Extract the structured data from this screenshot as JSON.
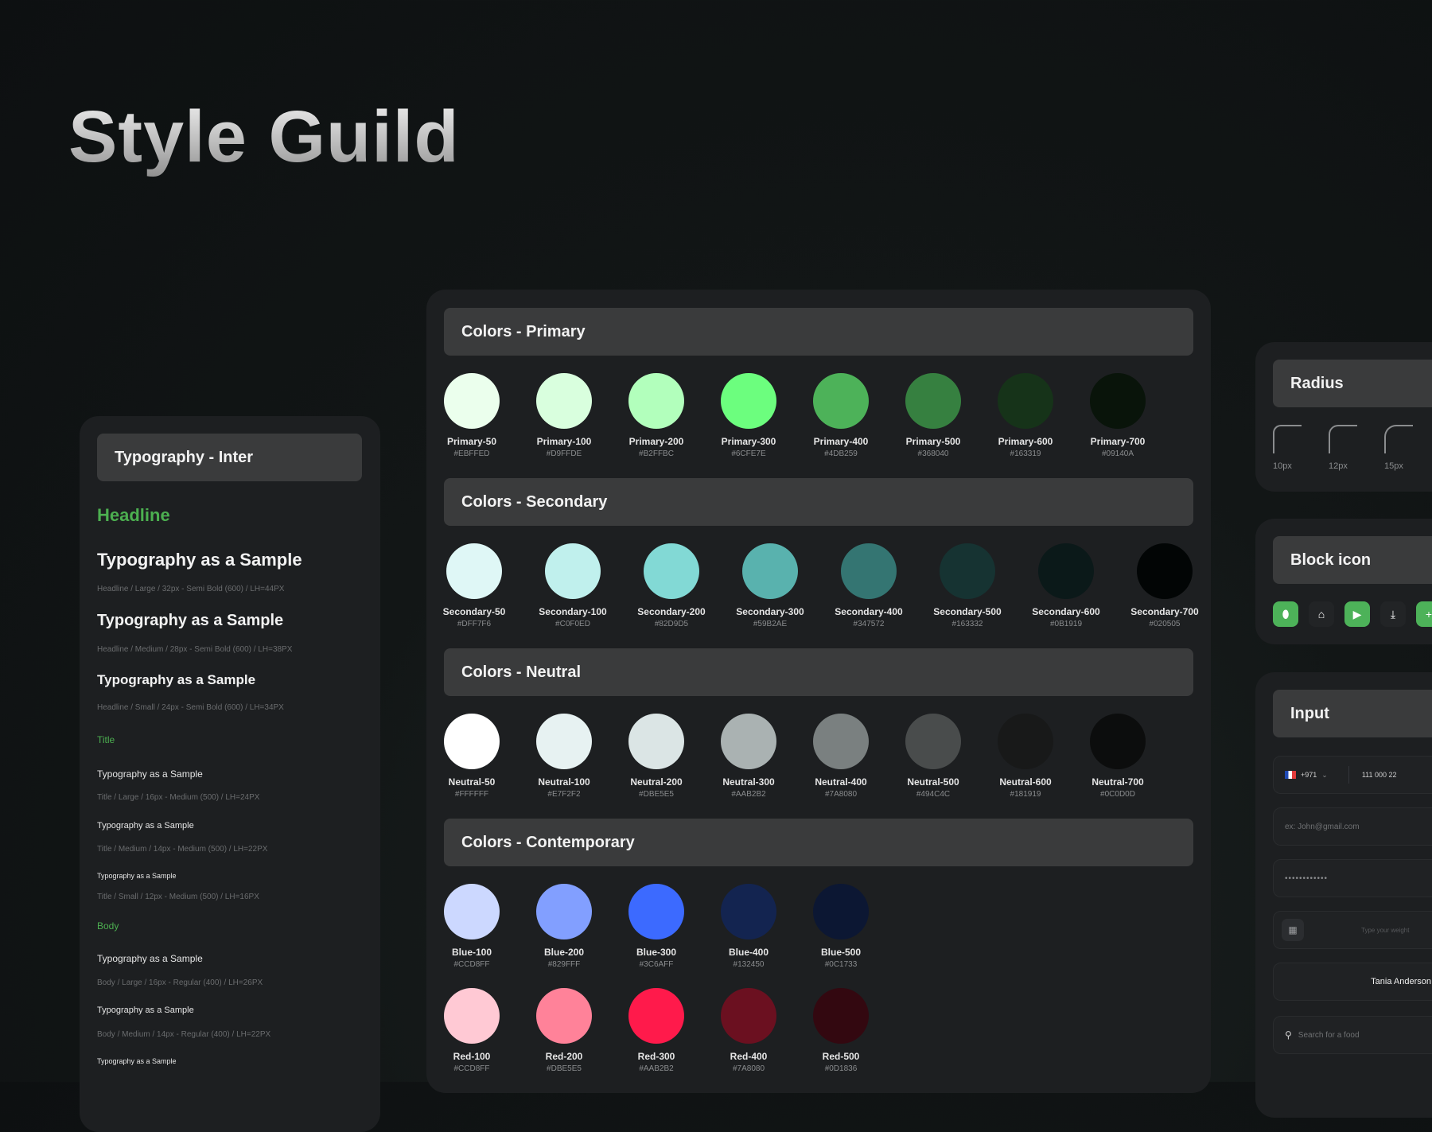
{
  "page_title": "Style Guild",
  "typography": {
    "header": "Typography - Inter",
    "headline_label": "Headline",
    "samples": [
      {
        "text": "Typography as a Sample",
        "meta": "Headline / Large / 32px - Semi Bold (600) / LH=44PX"
      },
      {
        "text": "Typography as a Sample",
        "meta": "Headline / Medium / 28px - Semi Bold (600) / LH=38PX"
      },
      {
        "text": "Typography as a Sample",
        "meta": "Headline / Small / 24px - Semi Bold (600) / LH=34PX"
      }
    ],
    "title_label": "Title",
    "title_samples": [
      {
        "text": "Typography as a Sample",
        "meta": "Title / Large / 16px - Medium (500) / LH=24PX"
      },
      {
        "text": "Typography as a Sample",
        "meta": "Title / Medium / 14px - Medium (500) / LH=22PX"
      },
      {
        "text": "Typography as a Sample",
        "meta": "Title / Small / 12px - Medium (500) / LH=16PX"
      }
    ],
    "body_label": "Body",
    "body_samples": [
      {
        "text": "Typography as a Sample",
        "meta": "Body / Large / 16px - Regular (400) / LH=26PX"
      },
      {
        "text": "Typography as a Sample",
        "meta": "Body / Medium / 14px - Regular (400) / LH=22PX"
      },
      {
        "text": "Typography as a Sample",
        "meta": ""
      }
    ]
  },
  "colors": {
    "primary": {
      "header": "Colors - Primary",
      "swatches": [
        {
          "name": "Primary-50",
          "hex": "#EBFFED",
          "color": "#EBFFED"
        },
        {
          "name": "Primary-100",
          "hex": "#D9FFDE",
          "color": "#D9FFDE"
        },
        {
          "name": "Primary-200",
          "hex": "#B2FFBC",
          "color": "#B2FFBC"
        },
        {
          "name": "Primary-300",
          "hex": "#6CFE7E",
          "color": "#6CFE7E"
        },
        {
          "name": "Primary-400",
          "hex": "#4DB259",
          "color": "#4DB259"
        },
        {
          "name": "Primary-500",
          "hex": "#368040",
          "color": "#368040"
        },
        {
          "name": "Primary-600",
          "hex": "#163319",
          "color": "#163319"
        },
        {
          "name": "Primary-700",
          "hex": "#09140A",
          "color": "#09140A"
        }
      ]
    },
    "secondary": {
      "header": "Colors - Secondary",
      "swatches": [
        {
          "name": "Secondary-50",
          "hex": "#DFF7F6",
          "color": "#DFF7F6"
        },
        {
          "name": "Secondary-100",
          "hex": "#C0F0ED",
          "color": "#C0F0ED"
        },
        {
          "name": "Secondary-200",
          "hex": "#82D9D5",
          "color": "#82D9D5"
        },
        {
          "name": "Secondary-300",
          "hex": "#59B2AE",
          "color": "#59B2AE"
        },
        {
          "name": "Secondary-400",
          "hex": "#347572",
          "color": "#347572"
        },
        {
          "name": "Secondary-500",
          "hex": "#163332",
          "color": "#163332"
        },
        {
          "name": "Secondary-600",
          "hex": "#0B1919",
          "color": "#0B1919"
        },
        {
          "name": "Secondary-700",
          "hex": "#020505",
          "color": "#020505"
        }
      ]
    },
    "neutral": {
      "header": "Colors - Neutral",
      "swatches": [
        {
          "name": "Neutral-50",
          "hex": "#FFFFFF",
          "color": "#FFFFFF"
        },
        {
          "name": "Neutral-100",
          "hex": "#E7F2F2",
          "color": "#E7F2F2"
        },
        {
          "name": "Neutral-200",
          "hex": "#DBE5E5",
          "color": "#DBE5E5"
        },
        {
          "name": "Neutral-300",
          "hex": "#AAB2B2",
          "color": "#AAB2B2"
        },
        {
          "name": "Neutral-400",
          "hex": "#7A8080",
          "color": "#7A8080"
        },
        {
          "name": "Neutral-500",
          "hex": "#494C4C",
          "color": "#494C4C"
        },
        {
          "name": "Neutral-600",
          "hex": "#181919",
          "color": "#181919"
        },
        {
          "name": "Neutral-700",
          "hex": "#0C0D0D",
          "color": "#0C0D0D"
        }
      ]
    },
    "contemporary": {
      "header": "Colors - Contemporary",
      "blue": [
        {
          "name": "Blue-100",
          "hex": "#CCD8FF",
          "color": "#CCD8FF"
        },
        {
          "name": "Blue-200",
          "hex": "#829FFF",
          "color": "#829FFF"
        },
        {
          "name": "Blue-300",
          "hex": "#3C6AFF",
          "color": "#3C6AFF"
        },
        {
          "name": "Blue-400",
          "hex": "#132450",
          "color": "#132450"
        },
        {
          "name": "Blue-500",
          "hex": "#0C1733",
          "color": "#0C1733"
        }
      ],
      "red": [
        {
          "name": "Red-100",
          "hex": "#CCD8FF",
          "color": "#FFC9D4"
        },
        {
          "name": "Red-200",
          "hex": "#DBE5E5",
          "color": "#FF8299"
        },
        {
          "name": "Red-300",
          "hex": "#AAB2B2",
          "color": "#FF1A4B"
        },
        {
          "name": "Red-400",
          "hex": "#7A8080",
          "color": "#6B1020"
        },
        {
          "name": "Red-500",
          "hex": "#0D1836",
          "color": "#330810"
        }
      ]
    }
  },
  "radius": {
    "header": "Radius",
    "items": [
      {
        "label": "10px",
        "radius": 10
      },
      {
        "label": "12px",
        "radius": 12
      },
      {
        "label": "15px",
        "radius": 15
      }
    ]
  },
  "block_icon": {
    "header": "Block icon",
    "icons": [
      {
        "name": "drop-icon",
        "glyph": "⬮",
        "bg": "#4DB259"
      },
      {
        "name": "home-icon",
        "glyph": "⌂",
        "bg": "#222426"
      },
      {
        "name": "play-icon",
        "glyph": "▶",
        "bg": "#4DB259"
      },
      {
        "name": "download-icon",
        "glyph": "⤓",
        "bg": "#222426"
      },
      {
        "name": "plus-icon",
        "glyph": "+",
        "bg": "#4DB259"
      }
    ]
  },
  "input": {
    "header": "Input",
    "phone_code": "+971",
    "phone_number": "111 000 22",
    "email_placeholder": "ex: John@gmail.com",
    "password_value": "••••••••••••",
    "weight_placeholder": "Type your weight",
    "name_value": "Tania Anderson",
    "search_placeholder": "Search for a food"
  }
}
